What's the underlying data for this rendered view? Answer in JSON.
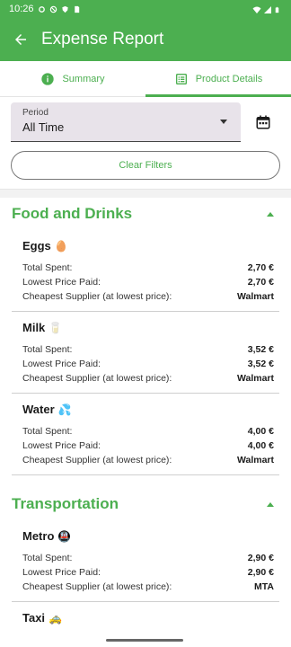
{
  "status": {
    "time": "10:26"
  },
  "app_bar": {
    "title": "Expense Report"
  },
  "tabs": [
    {
      "label": "Summary"
    },
    {
      "label": "Product Details"
    }
  ],
  "filters": {
    "period_label": "Period",
    "period_value": "All Time",
    "clear_label": "Clear Filters"
  },
  "sections": [
    {
      "title": "Food and Drinks",
      "items": [
        {
          "name": "Eggs",
          "emoji": "🥚",
          "total": "2,70 €",
          "lowest": "2,70 €",
          "supplier": "Walmart"
        },
        {
          "name": "Milk",
          "emoji": "🥛",
          "total": "3,52 €",
          "lowest": "3,52 €",
          "supplier": "Walmart"
        },
        {
          "name": "Water",
          "emoji": "💦",
          "total": "4,00 €",
          "lowest": "4,00 €",
          "supplier": "Walmart"
        }
      ]
    },
    {
      "title": "Transportation",
      "items": [
        {
          "name": "Metro",
          "emoji": "🚇",
          "total": "2,90 €",
          "lowest": "2,90 €",
          "supplier": "MTA"
        },
        {
          "name": "Taxi",
          "emoji": "🚕"
        }
      ]
    }
  ],
  "labels": {
    "total_spent": "Total Spent:",
    "lowest_price": "Lowest Price Paid:",
    "cheapest_supplier": "Cheapest Supplier (at lowest price):"
  },
  "colors": {
    "primary": "#4caf50"
  }
}
